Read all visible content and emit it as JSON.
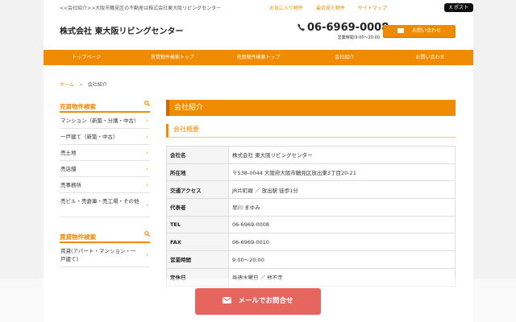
{
  "header": {
    "tagline": "<<会社紹介>>大阪市鶴見区の不動産は株式会社東大阪リビングセンター",
    "links": [
      "お気に入り物件",
      "最近見た物件",
      "サイトマップ"
    ],
    "x_post": "X ポスト",
    "company": "株式会社 東大阪リビングセンター",
    "phone": "06-6969-0008",
    "hours": "営業時間/9:00〜20:00",
    "contact_label": "お問い合わせ"
  },
  "nav": [
    "トップページ",
    "賃貸物件検索トップ",
    "売買物件検索トップ",
    "会社紹介",
    "お問い合わせ"
  ],
  "breadcrumb": {
    "home": "ホーム",
    "sep": ">",
    "current": "会社紹介"
  },
  "sidebar": {
    "sale": {
      "title": "売買物件検索",
      "items": [
        "マンション（新築・分譲・中古）",
        "一戸建て（新築・中古）",
        "売土地",
        "売店舗",
        "売事務所",
        "売ビル・売倉庫・売工場・その他"
      ]
    },
    "rent": {
      "title": "賃貸物件検索",
      "items": [
        "賃貸(アパート・マンション・一戸建て)"
      ]
    }
  },
  "main": {
    "title": "会社紹介",
    "subtitle": "会社概要",
    "rows": [
      {
        "k": "会社名",
        "v": "株式会社 東大阪リビングセンター"
      },
      {
        "k": "所在地",
        "v": "〒538-0044 大阪府大阪市鶴見区放出東3丁目20-21"
      },
      {
        "k": "交通アクセス",
        "v": "JR片町線 ／ 放出駅 徒歩1分"
      },
      {
        "k": "代表者",
        "v": "早川 まゆみ"
      },
      {
        "k": "TEL",
        "v": "06-6969-0008"
      },
      {
        "k": "FAX",
        "v": "06-6969-0010"
      },
      {
        "k": "営業時間",
        "v": "9:00〜20:00"
      },
      {
        "k": "定休日",
        "v": "毎週水曜日 ／ 他不定"
      }
    ]
  },
  "floating_button": {
    "label": "メールでお問合せ"
  },
  "colors": {
    "accent": "#f08a00",
    "float_button": "#e4665f"
  }
}
